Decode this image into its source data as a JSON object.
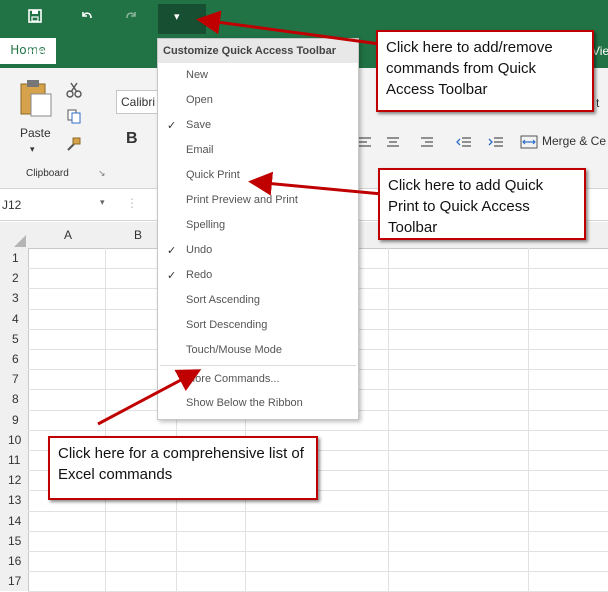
{
  "qat": {
    "save_icon": "save-icon",
    "undo_icon": "undo-icon",
    "redo_icon": "redo-icon",
    "dropdown_icon": "customize-dropdown-icon",
    "dropdown_glyph": "▾"
  },
  "tabs": {
    "file": "File",
    "home": "Home",
    "view_partial": "Vie"
  },
  "ribbon": {
    "paste": "Paste",
    "clipboard": "Clipboard",
    "font_name": "Calibri",
    "bold": "B",
    "merge": "Merge & Ce",
    "t_partial": "t"
  },
  "formula": {
    "name_box": "J12"
  },
  "columns": [
    "A",
    "B"
  ],
  "rows": [
    "1",
    "2",
    "3",
    "4",
    "5",
    "6",
    "7",
    "8",
    "9",
    "10",
    "11",
    "12",
    "13",
    "14",
    "15",
    "16",
    "17"
  ],
  "menu": {
    "header": "Customize Quick Access Toolbar",
    "items": [
      {
        "label": "New",
        "checked": false
      },
      {
        "label": "Open",
        "checked": false
      },
      {
        "label": "Save",
        "checked": true
      },
      {
        "label": "Email",
        "checked": false
      },
      {
        "label": "Quick Print",
        "checked": false
      },
      {
        "label": "Print Preview and Print",
        "checked": false
      },
      {
        "label": "Spelling",
        "checked": false
      },
      {
        "label": "Undo",
        "checked": true
      },
      {
        "label": "Redo",
        "checked": true
      },
      {
        "label": "Sort Ascending",
        "checked": false
      },
      {
        "label": "Sort Descending",
        "checked": false
      },
      {
        "label": "Touch/Mouse Mode",
        "checked": false
      },
      {
        "label": "More Commands...",
        "checked": false
      },
      {
        "label": "Show Below the Ribbon",
        "checked": false
      }
    ],
    "check_glyph": "✓"
  },
  "callouts": {
    "top": "Click here to add/remove commands from Quick Access Toolbar",
    "middle": "Click here to add Quick Print to Quick Access Toolbar",
    "bottom": "Click here for a comprehensive list of Excel commands"
  },
  "colors": {
    "excel_green": "#217346",
    "callout_border": "#c00000",
    "arrow": "#c00000"
  }
}
